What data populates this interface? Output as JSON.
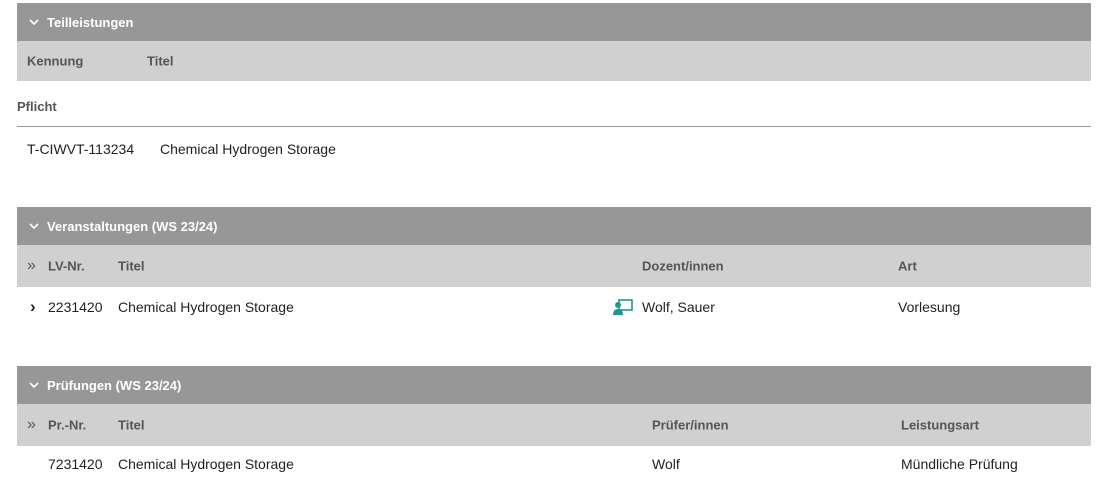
{
  "teilleistungen": {
    "header": "Teilleistungen",
    "columns": {
      "kennung": "Kennung",
      "titel": "Titel"
    },
    "group": "Pflicht",
    "rows": [
      {
        "kennung": "T-CIWVT-113234",
        "titel": "Chemical Hydrogen Storage"
      }
    ]
  },
  "veranstaltungen": {
    "header": "Veranstaltungen (WS 23/24)",
    "columns": {
      "expand_all": "»",
      "lv_nr": "LV-Nr.",
      "titel": "Titel",
      "dozent": "Dozent/innen",
      "art": "Art"
    },
    "rows": [
      {
        "expand": "›",
        "lv_nr": "2231420",
        "titel": "Chemical Hydrogen Storage",
        "dozent": "Wolf, Sauer",
        "art": "Vorlesung",
        "icon": "lecturer-icon"
      }
    ]
  },
  "pruefungen": {
    "header": "Prüfungen (WS 23/24)",
    "columns": {
      "expand_all": "»",
      "pr_nr": "Pr.-Nr.",
      "titel": "Titel",
      "pruefer": "Prüfer/innen",
      "leistungsart": "Leistungsart"
    },
    "rows": [
      {
        "pr_nr": "7231420",
        "titel": "Chemical Hydrogen Storage",
        "pruefer": "Wolf",
        "leistungsart": "Mündliche Prüfung"
      }
    ]
  },
  "colors": {
    "section_header": "#979797",
    "column_header": "#d0d0d0",
    "icon_teal": "#1a9a8a"
  }
}
